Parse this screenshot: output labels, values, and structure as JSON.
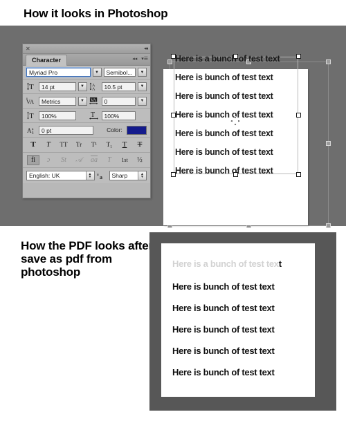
{
  "headings": {
    "top": "How it looks in Photoshop",
    "bottom": "How the PDF looks after save as pdf from photoshop"
  },
  "colors": {
    "stage_top_bg": "#6e6e6e",
    "stage_bottom_bg": "#575757",
    "panel_bg": "#bdbdbd",
    "text_color_swatch": "#141b8c",
    "faded_text": "#d2d2d2",
    "body_text": "#111111"
  },
  "character_panel": {
    "title_tab": "Character",
    "close_icon": "close-icon",
    "collapse_icon": "collapse-icon",
    "menu_icon": "panel-menu-icon",
    "font_family": {
      "label": "font-family",
      "value": "Myriad Pro"
    },
    "font_style": {
      "label": "font-style",
      "value": "Semibol..."
    },
    "font_size": {
      "icon": "font-size-icon",
      "value": "14 pt"
    },
    "leading": {
      "icon": "leading-icon",
      "value": "10.5 pt"
    },
    "kerning": {
      "icon": "kerning-icon",
      "value": "Metrics"
    },
    "tracking": {
      "icon": "tracking-icon",
      "value": "0"
    },
    "vertical_scale": {
      "icon": "vertical-scale-icon",
      "value": "100%"
    },
    "horizontal_scale": {
      "icon": "horizontal-scale-icon",
      "value": "100%"
    },
    "baseline_shift": {
      "icon": "baseline-shift-icon",
      "value": "0 pt"
    },
    "color": {
      "label": "Color:",
      "value": "#141b8c"
    },
    "style_buttons": [
      {
        "name": "faux-bold",
        "glyph": "T"
      },
      {
        "name": "faux-italic",
        "glyph": "T"
      },
      {
        "name": "all-caps",
        "glyph": "TT"
      },
      {
        "name": "small-caps",
        "glyph": "Tr"
      },
      {
        "name": "superscript",
        "glyph": "T¹"
      },
      {
        "name": "subscript",
        "glyph": "T₁"
      },
      {
        "name": "underline",
        "glyph": "T"
      },
      {
        "name": "strikethrough",
        "glyph": "T"
      }
    ],
    "opentype_buttons": [
      {
        "name": "standard-ligatures",
        "glyph": "fi",
        "active": true
      },
      {
        "name": "contextual-alternates",
        "glyph": "ɔ",
        "active": false
      },
      {
        "name": "discretionary-ligatures",
        "glyph": "St",
        "active": false
      },
      {
        "name": "swash",
        "glyph": "𝒜",
        "active": false
      },
      {
        "name": "oldstyle",
        "glyph": "aa",
        "active": false
      },
      {
        "name": "titling-alternates",
        "glyph": "T",
        "active": false
      },
      {
        "name": "ordinals",
        "glyph": "1st",
        "active": false
      },
      {
        "name": "fractions",
        "glyph": "½",
        "active": false
      }
    ],
    "language": {
      "label": "language-select",
      "value": "English: UK"
    },
    "antialias_icon": "anti-alias-icon",
    "antialias": {
      "label": "anti-alias-select",
      "value": "Sharp"
    }
  },
  "photoshop_canvas": {
    "lines": [
      "Here is a bunch of test text",
      "Here is bunch of test text",
      "Here is bunch of test text",
      "Here is bunch of test text",
      "Here is bunch of test text",
      "Here is bunch of test text",
      "Here is bunch of test text"
    ],
    "cursor": "move-cursor"
  },
  "pdf_page": {
    "faded_line_head": "Here is a bunch of test tex",
    "faded_line_tail": "t",
    "lines": [
      "Here is bunch of test text",
      "Here is bunch of test text",
      "Here is bunch of test text",
      "Here is bunch of test text",
      "Here is bunch of test text"
    ]
  }
}
